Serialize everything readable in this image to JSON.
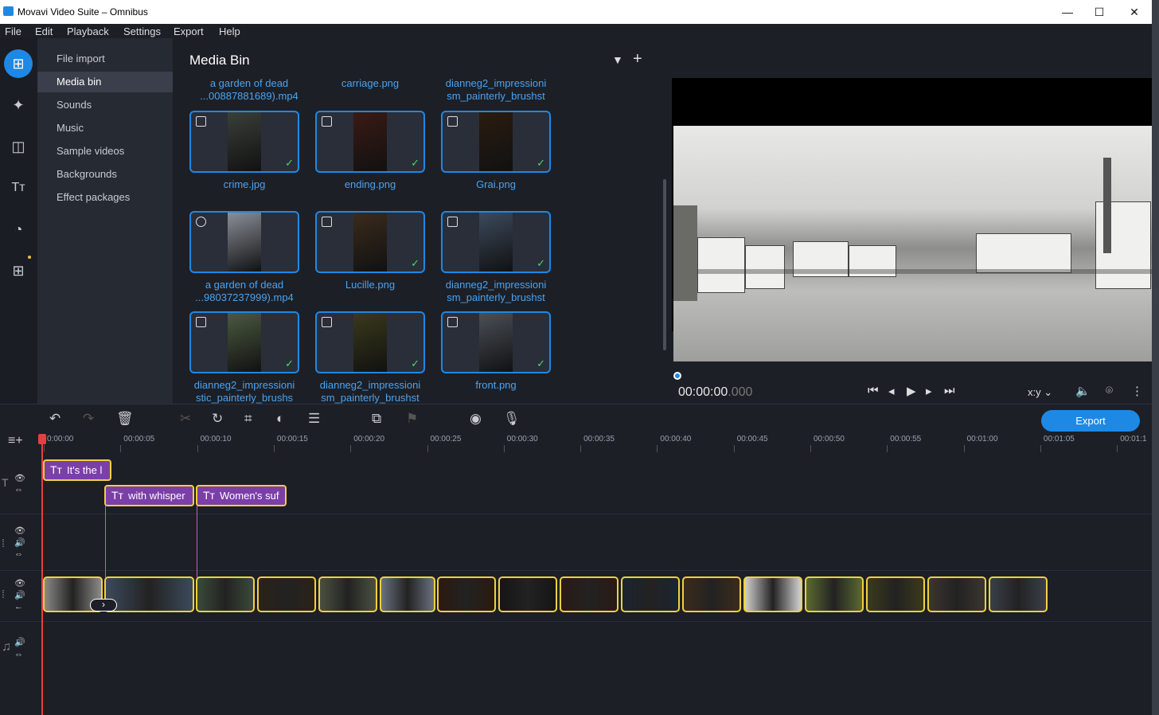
{
  "window": {
    "title": "Movavi Video Suite – Omnibus"
  },
  "menu": [
    "File",
    "Edit",
    "Playback",
    "Settings",
    "Export",
    "Help"
  ],
  "categories": [
    "File import",
    "Media bin",
    "Sounds",
    "Music",
    "Sample videos",
    "Backgrounds",
    "Effect packages"
  ],
  "selected_category": "Media bin",
  "media_bin": {
    "title": "Media Bin",
    "top_labels": [
      [
        "a garden of dead",
        "...00887881689).mp4"
      ],
      [
        "carriage.png",
        ""
      ],
      [
        "dianneg2_impressioni",
        "sm_painterly_brushst"
      ]
    ],
    "rows": [
      [
        {
          "label1": "crime.jpg",
          "label2": "",
          "kind": "image",
          "checked": true,
          "color": "#3a3f3a"
        },
        {
          "label1": "ending.png",
          "label2": "",
          "kind": "image",
          "checked": true,
          "color": "#3a1a14"
        },
        {
          "label1": "Grai.png",
          "label2": "",
          "kind": "image",
          "checked": true,
          "color": "#2a1c10"
        }
      ],
      [
        {
          "label1": "a garden of dead",
          "label2": "...98037237999).mp4",
          "kind": "video",
          "checked": false,
          "color": "#8a8f98"
        },
        {
          "label1": "Lucille.png",
          "label2": "",
          "kind": "image",
          "checked": true,
          "color": "#3b2b1c"
        },
        {
          "label1": "dianneg2_impressioni",
          "label2": "sm_painterly_brushst",
          "kind": "image",
          "checked": true,
          "color": "#3c4a5c"
        }
      ],
      [
        {
          "label1": "dianneg2_impressioni",
          "label2": "stic_painterly_brushs",
          "kind": "image",
          "checked": true,
          "color": "#4a5a40"
        },
        {
          "label1": "dianneg2_impressioni",
          "label2": "sm_painterly_brushst",
          "kind": "image",
          "checked": true,
          "color": "#3a3a1c"
        },
        {
          "label1": "front.png",
          "label2": "",
          "kind": "image",
          "checked": true,
          "color": "#4a5058"
        }
      ]
    ]
  },
  "preview": {
    "time_main": "00:00:00",
    "time_ms": ".000",
    "aspect": "x:y"
  },
  "toolbar": {
    "export_label": "Export"
  },
  "ruler_ticks": [
    "0:00:00",
    "00:00:05",
    "00:00:10",
    "00:00:15",
    "00:00:20",
    "00:00:25",
    "00:00:30",
    "00:00:35",
    "00:00:40",
    "00:00:45",
    "00:00:50",
    "00:00:55",
    "00:01:00",
    "00:01:05",
    "00:01:1"
  ],
  "title_clips": [
    {
      "text": "It's the l",
      "track": 1
    },
    {
      "text": "with whisper",
      "track": 2
    },
    {
      "text": "Women's suf",
      "track": 2
    }
  ],
  "video_clips_count": 16,
  "colors": {
    "accent": "#1e88e5",
    "title_clip": "#7b3fa8",
    "clip_border": "#f0d040",
    "playhead": "#e54040"
  }
}
